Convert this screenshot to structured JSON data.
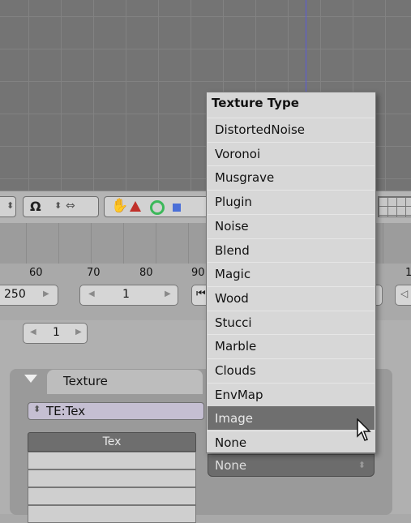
{
  "menu": {
    "title": "Texture Type",
    "items": [
      "DistortedNoise",
      "Voronoi",
      "Musgrave",
      "Plugin",
      "Noise",
      "Blend",
      "Magic",
      "Wood",
      "Stucci",
      "Marble",
      "Clouds",
      "EnvMap",
      "Image",
      "None"
    ],
    "selected_index": 12
  },
  "timeline": {
    "ticks": [
      "60",
      "70",
      "80",
      "90",
      "1"
    ],
    "end_frame": "250",
    "current_frame": "1",
    "step_frame": "1"
  },
  "panel": {
    "tab_label": "Texture",
    "texture_name": "TE:Tex",
    "list_header": "Tex",
    "type_select_value": "None"
  },
  "colors": {
    "menu_bg": "#d7d7d7",
    "menu_selected": "#6f6f6f",
    "viewport_line": "#5a5ad8"
  }
}
